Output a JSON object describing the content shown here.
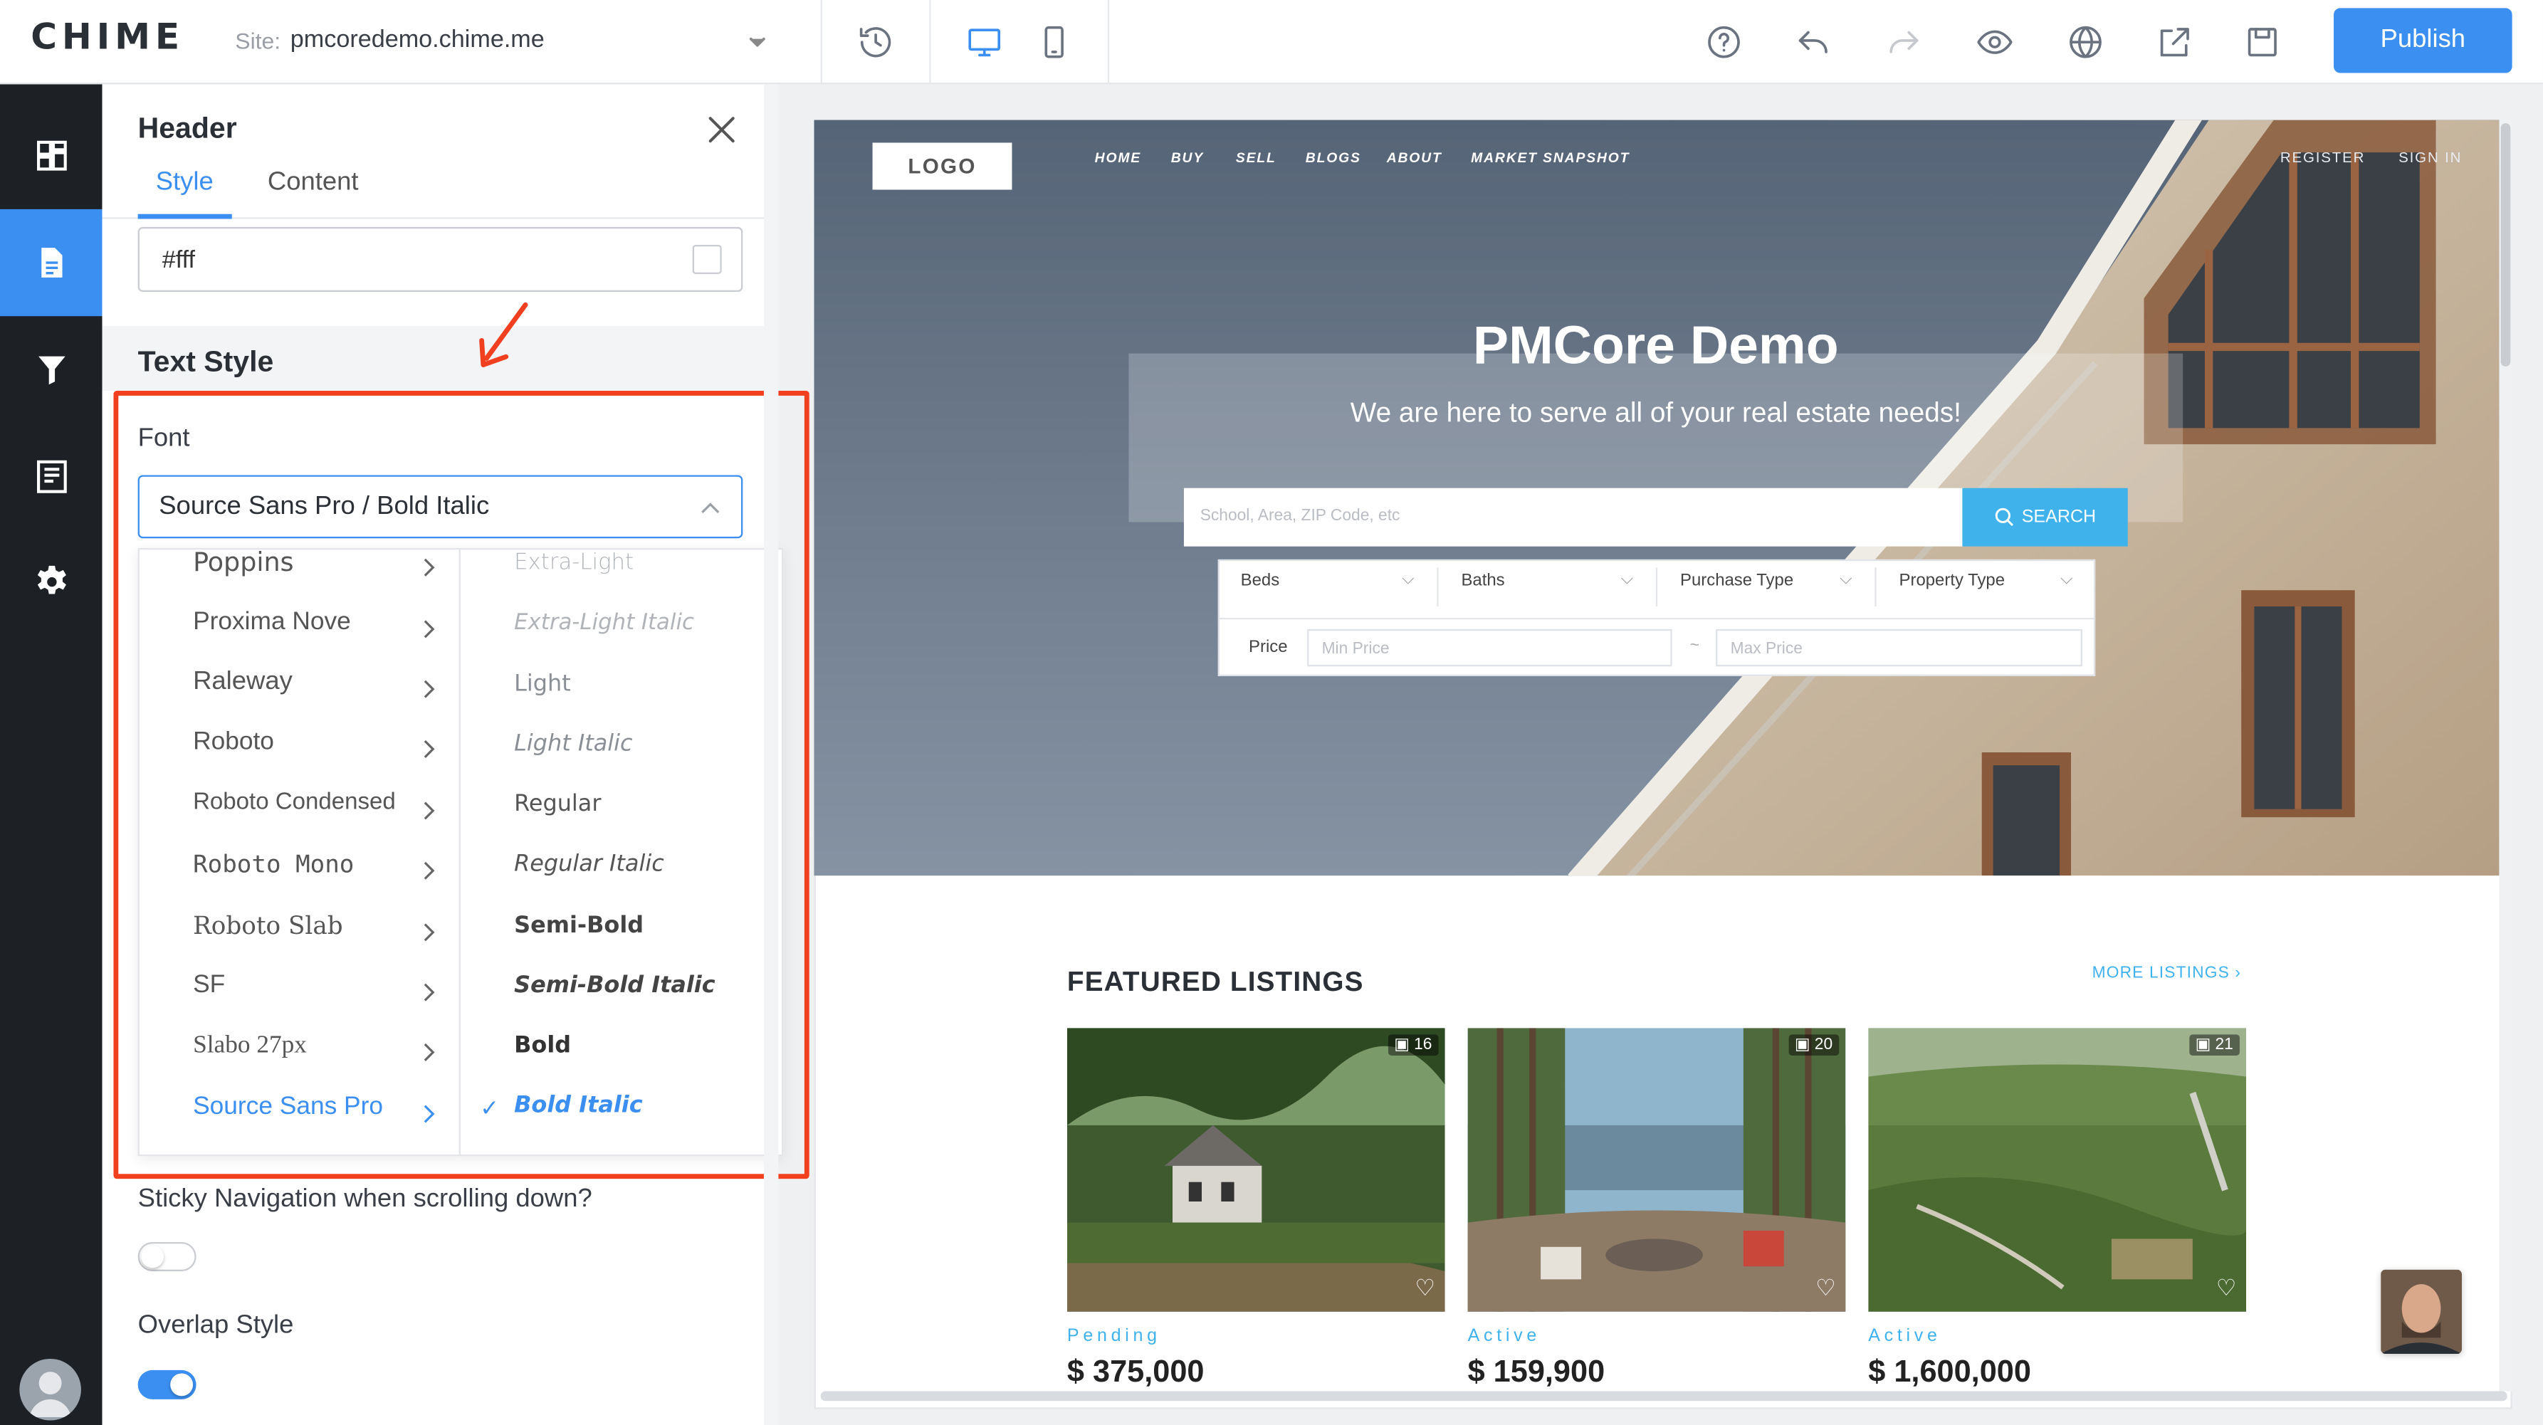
{
  "topbar": {
    "logo": "CHIME",
    "site_label": "Site:",
    "site_value": "pmcoredemo.chime.me",
    "publish_label": "Publish"
  },
  "panel": {
    "title": "Header",
    "tabs": [
      {
        "label": "Style"
      },
      {
        "label": "Content"
      }
    ],
    "color_value": "#fff",
    "section_title": "Text Style",
    "font_label": "Font",
    "font_value": "Source Sans Pro / Bold Italic",
    "font_families": [
      "Poppins",
      "Proxima Nove",
      "Raleway",
      "Roboto",
      "Roboto Condensed",
      "Roboto Mono",
      "Roboto Slab",
      "SF",
      "Slabo 27px",
      "Source Sans Pro"
    ],
    "selected_family": "Source Sans Pro",
    "font_variants": [
      "Extra-Light",
      "Extra-Light Italic",
      "Light",
      "Light Italic",
      "Regular",
      "Regular Italic",
      "Semi-Bold",
      "Semi-Bold Italic",
      "Bold",
      "Bold Italic"
    ],
    "selected_variant": "Bold Italic",
    "sticky_label": "Sticky Navigation when scrolling down?",
    "sticky_on": false,
    "overlap_label": "Overlap Style",
    "overlap_on": true
  },
  "preview": {
    "logo": "LOGO",
    "nav": [
      "HOME",
      "BUY",
      "SELL",
      "BLOGS",
      "ABOUT",
      "MARKET SNAPSHOT"
    ],
    "nav_right": [
      "REGISTER",
      "SIGN IN"
    ],
    "hero_title": "PMCore Demo",
    "hero_subtitle": "We are here to serve all of your real estate needs!",
    "search_placeholder": "School, Area, ZIP Code, etc",
    "search_button": "SEARCH",
    "filters": [
      "Beds",
      "Baths",
      "Purchase Type",
      "Property Type"
    ],
    "price_label": "Price",
    "min_price": "Min Price",
    "max_price": "Max Price",
    "price_dash": "~",
    "featured_title": "FEATURED LISTINGS",
    "more_listings": "MORE LISTINGS",
    "listings": [
      {
        "status": "Pending",
        "price": "$ 375,000",
        "photos": "16"
      },
      {
        "status": "Active",
        "price": "$ 159,900",
        "photos": "20"
      },
      {
        "status": "Active",
        "price": "$ 1,600,000",
        "photos": "21"
      }
    ]
  },
  "colors": {
    "accent": "#3a8ff0",
    "highlight": "#f0401f",
    "link": "#3fb2ec"
  }
}
